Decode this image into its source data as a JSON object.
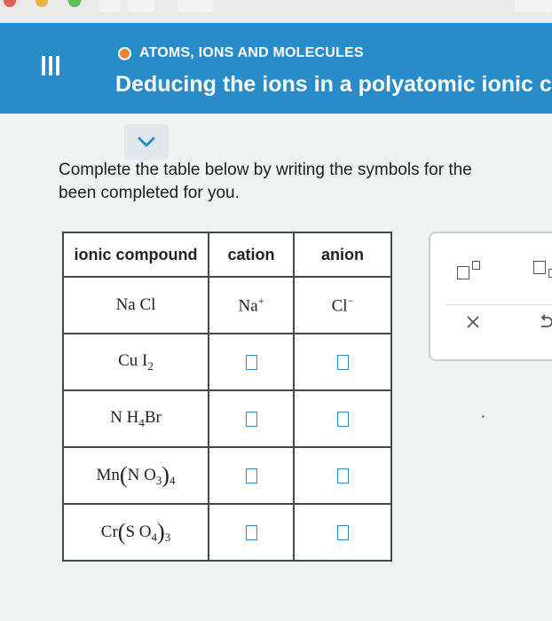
{
  "header": {
    "topic": "ATOMS, IONS AND MOLECULES",
    "title": "Deducing the ions in a polyatomic ionic compou"
  },
  "prompt": {
    "line1": "Complete the table below by writing the symbols for the",
    "line2": "been completed for you."
  },
  "table": {
    "headers": [
      "ionic compound",
      "cation",
      "anion"
    ],
    "rows": [
      {
        "compound": "NaCl",
        "cation": "Na+",
        "anion": "Cl−"
      },
      {
        "compound": "CuI2",
        "cation": "",
        "anion": ""
      },
      {
        "compound": "NH4Br",
        "cation": "",
        "anion": ""
      },
      {
        "compound": "Mn(NO3)4",
        "cation": "",
        "anion": ""
      },
      {
        "compound": "Cr(SO4)3",
        "cation": "",
        "anion": ""
      }
    ]
  },
  "tools": [
    "superscript-tool",
    "subscript-tool",
    "clear",
    "undo"
  ],
  "colors": {
    "header_bg": "#2a8bc9",
    "topic_dot": "#e8833a",
    "answer_box": "#2a8bc9"
  }
}
